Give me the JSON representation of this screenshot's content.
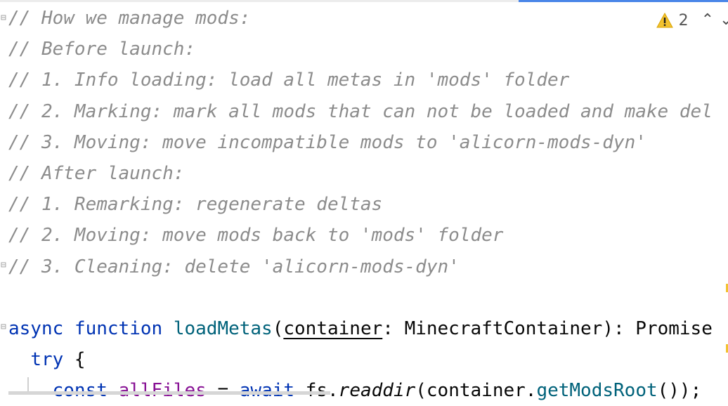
{
  "editor": {
    "lines": [
      [
        {
          "t": "// How we manage mods:",
          "c": "cmt"
        }
      ],
      [
        {
          "t": "// Before launch:",
          "c": "cmt"
        }
      ],
      [
        {
          "t": "// 1. Info loading: load all metas in 'mods' folder",
          "c": "cmt"
        }
      ],
      [
        {
          "t": "// 2. Marking: mark all mods that can not be loaded and make del",
          "c": "cmt"
        }
      ],
      [
        {
          "t": "// 3. Moving: move incompatible mods to 'alicorn-mods-dyn'",
          "c": "cmt"
        }
      ],
      [
        {
          "t": "// After launch:",
          "c": "cmt"
        }
      ],
      [
        {
          "t": "// 1. Remarking: regenerate deltas",
          "c": "cmt"
        }
      ],
      [
        {
          "t": "// 2. Moving: move mods back to 'mods' folder",
          "c": "cmt"
        }
      ],
      [
        {
          "t": "// 3. Cleaning: delete 'alicorn-mods-dyn'",
          "c": "cmt"
        }
      ],
      [
        {
          "t": "",
          "c": ""
        }
      ],
      [
        {
          "t": "async",
          "c": "kw"
        },
        {
          "t": " ",
          "c": ""
        },
        {
          "t": "function",
          "c": "kw"
        },
        {
          "t": " ",
          "c": ""
        },
        {
          "t": "loadMetas",
          "c": "fn"
        },
        {
          "t": "(",
          "c": ""
        },
        {
          "t": "container",
          "c": "param"
        },
        {
          "t": ": MinecraftContainer): Promise",
          "c": ""
        }
      ],
      [
        {
          "t": "  ",
          "c": ""
        },
        {
          "t": "try",
          "c": "kw"
        },
        {
          "t": " {",
          "c": ""
        }
      ],
      [
        {
          "t": "    ",
          "c": ""
        },
        {
          "t": "const",
          "c": "kw"
        },
        {
          "t": " ",
          "c": ""
        },
        {
          "t": "allFiles",
          "c": "var"
        },
        {
          "t": " = ",
          "c": ""
        },
        {
          "t": "await",
          "c": "kw"
        },
        {
          "t": " fs.",
          "c": ""
        },
        {
          "t": "readdir",
          "c": "method"
        },
        {
          "t": "(container.",
          "c": ""
        },
        {
          "t": "getModsRoot",
          "c": "call"
        },
        {
          "t": "());",
          "c": ""
        }
      ]
    ]
  },
  "inspection": {
    "warning_count": "2",
    "warning_color": "#f2c230",
    "icons": [
      "warning-icon",
      "chevron-up-icon",
      "chevron-down-icon"
    ]
  }
}
